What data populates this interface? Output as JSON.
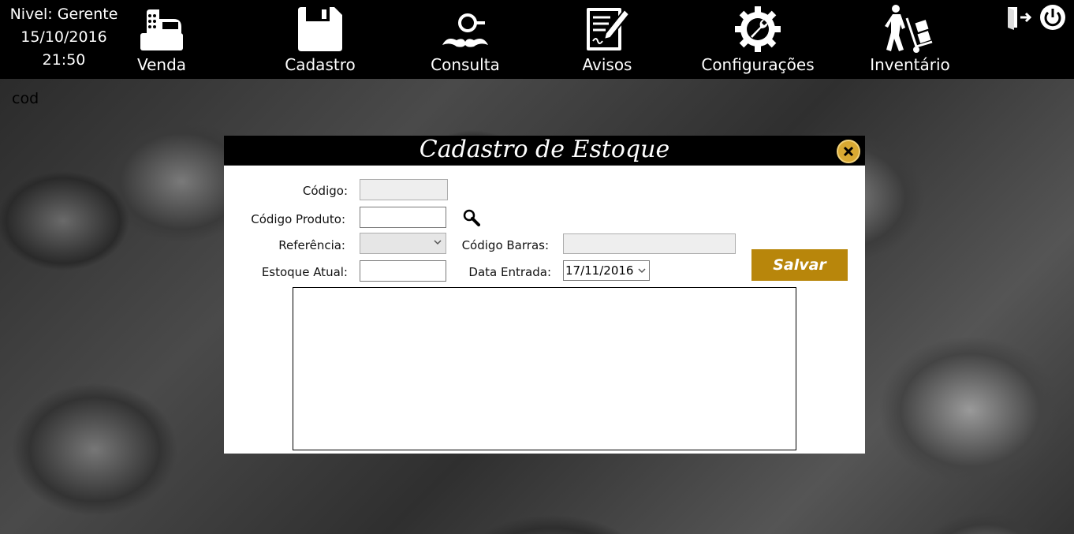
{
  "status": {
    "level": "Nivel: Gerente",
    "date": "15/10/2016",
    "time": "21:50"
  },
  "nav": [
    {
      "label": "Venda",
      "icon": "cash-register-icon"
    },
    {
      "label": "Cadastro",
      "icon": "save-disk-icon"
    },
    {
      "label": "Consulta",
      "icon": "detective-mustache-icon"
    },
    {
      "label": "Avisos",
      "icon": "document-edit-icon"
    },
    {
      "label": "Configurações",
      "icon": "gear-wrench-icon"
    },
    {
      "label": "Inventário",
      "icon": "hand-truck-icon"
    }
  ],
  "top_right_icons": [
    "logout-icon",
    "power-icon"
  ],
  "background_label": "cod",
  "modal": {
    "title": "Cadastro de Estoque",
    "close_icon": "close-icon",
    "fields": {
      "codigo_label": "Código:",
      "codigo_value": "",
      "codigo_produto_label": "Código Produto:",
      "codigo_produto_value": "",
      "referencia_label": "Referência:",
      "referencia_value": "",
      "codigo_barras_label": "Código Barras:",
      "codigo_barras_value": "",
      "estoque_atual_label": "Estoque Atual:",
      "estoque_atual_value": "",
      "data_entrada_label": "Data Entrada:",
      "data_entrada_value": "17/11/2016"
    },
    "save_label": "Salvar"
  },
  "colors": {
    "accent": "#b8860b",
    "close": "#d9a932",
    "topbar": "#000000"
  }
}
